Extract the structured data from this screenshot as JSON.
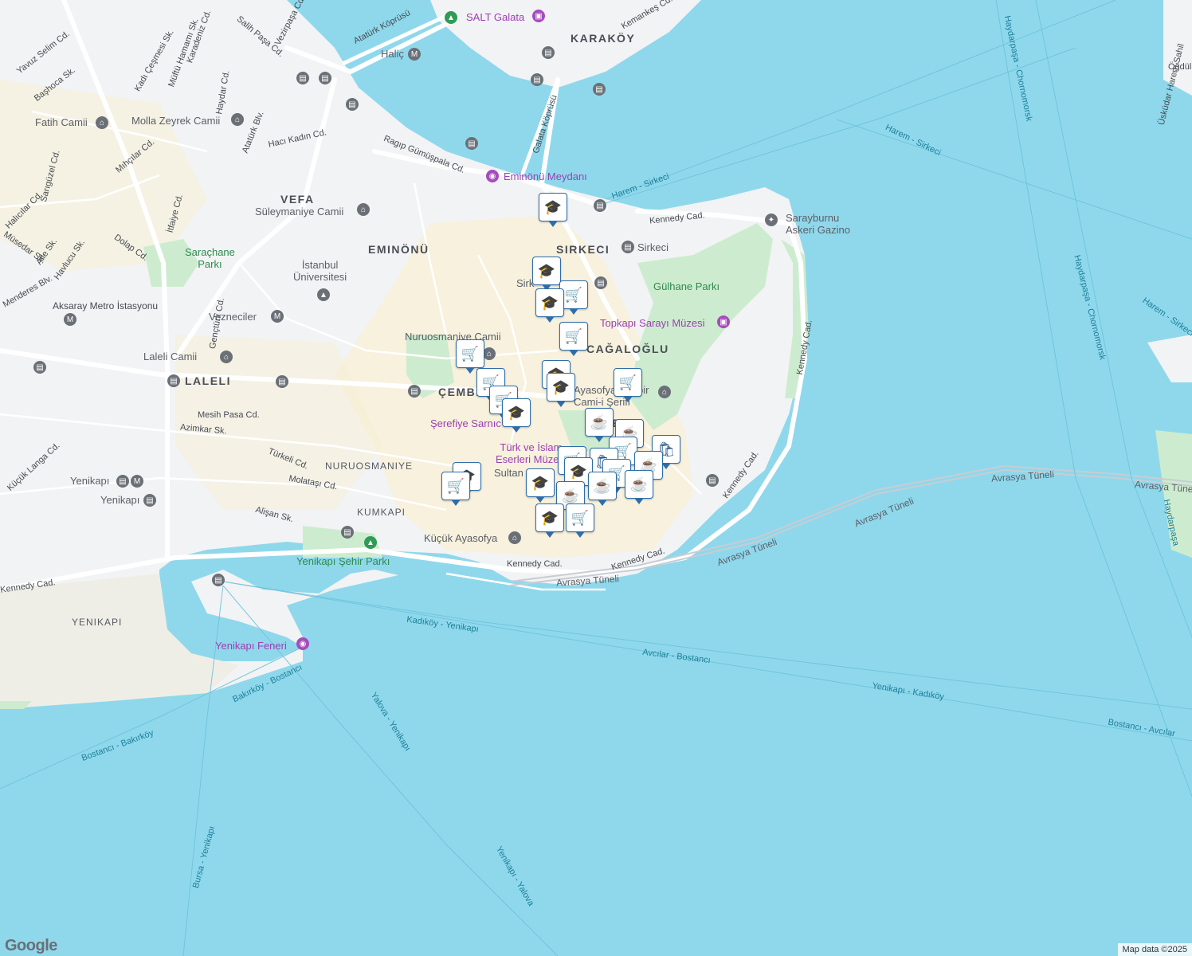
{
  "map": {
    "attribution": "Map data ©2025",
    "logo": "Google",
    "colors": {
      "water": "#8fd8ec",
      "land": "#f2f3f4",
      "park": "#cdeccf",
      "road": "#ffffff",
      "tourist": "#f8f0d5",
      "pin_border": "#2e6da8",
      "poi_purple": "#9c3fb3"
    }
  },
  "districts": {
    "karakoy": "KARAKÖY",
    "sirkeci": "SIRKECI",
    "eminonu": "EMINÖNÜ",
    "vefa": "VEFA",
    "laleli": "LALELI",
    "cagaloglu": "CAĞALOĞLU",
    "cemberlitas": "ÇEMBE",
    "nuruosmaniye": "NURUOSMANIYE",
    "kumkapi": "KUMKAPI",
    "yenikapi": "YENIKAPI",
    "sultanahmet": "S         MET"
  },
  "streets": {
    "yavuz_selim": "Yavuz Selim Cd.",
    "bashoca": "Başhoca Sk.",
    "kadi_cesmesi": "Kadı Çeşmesi Sk.",
    "muftu_hamami": "Müftü Hamamı Sk.",
    "karadeniz": "Karadeniz Cd.",
    "salih_pasa": "Salih Paşa Cd.",
    "vezirpasa": "Vezirpaşa Cd.",
    "haydar": "Haydar Cd.",
    "ataturk_bulv": "Atatürk Blv.",
    "haci_kadin": "Hacı Kadın Cd.",
    "mihcilar": "Mıhçılar Cd.",
    "sarigüzel": "Sarıgüzel Cd.",
    "halicilar": "Halıcılar Cd.",
    "itfaiye": "İtfaiye Cd.",
    "dolap": "Dolap Cd.",
    "mesedar": "Müsedar Sk.",
    "alle": "Alle Sk.",
    "havlucu": "Havlucu Sk.",
    "menderes": "Menderes Blv.",
    "aksaray_metro": "Aksaray Metro İstasyonu",
    "gencturk": "Gençtürk Cd.",
    "ragip": "Ragıp Gümüşpala Cd.",
    "kennedy1": "Kennedy Cad.",
    "kennedy2": "Kennedy Cad.",
    "kennedy3": "Kennedy Cad.",
    "kennedy4": "Kennedy Cad.",
    "kennedy5": "Kennedy Cad.",
    "kennedy6": "Kennedy Cad.",
    "kemankes": "Kemankeş Cd.",
    "mesih_pasa": "Mesih Pasa Cd.",
    "azimkar": "Azimkar Sk.",
    "kucuk_langa": "Küçük Langa Cd.",
    "turkeli": "Türkeli Cd.",
    "molatasi": "Molataşı Cd.",
    "alisan": "Alişan Sk.",
    "ataturk_koprusu": "Atatürk Köprüsü",
    "galata_koprusu": "Galata Köprüsü"
  },
  "pois": {
    "salt_galata": "SALT Galata",
    "halic": "Haliç",
    "fatih_camii": "Fatih Camii",
    "molla_zeyrek": "Molla Zeyrek Camii",
    "suleymaniye": "Süleymaniye Camii",
    "sarachane": "Saraçhane\nParkı",
    "istanbul_uni": "İstanbul\nÜniversitesi",
    "vezneciler": "Vezneciler",
    "eminonu_meydani": "Eminönü Meydanı",
    "nuruosmaniye_camii": "Nuruosmaniye Camii",
    "laleli_camii": "Laleli Camii",
    "gulhane": "Gülhane Parkı",
    "topkapi": "Topkapı Sarayı Müzesi",
    "sarayburnu": "Sarayburnu\nAskeri Gazino",
    "sirkeci_station": "Sirkeci",
    "serefiye": "Şerefiye Sarnıc",
    "ayasofya": "Ayasofya-i Kebir\nCami-i Şerifi",
    "turk_islam": "Türk ve İslam\nEserleri Müzesi",
    "sultan": "Sultan",
    "kucuk_ayasofya": "Küçük Ayasofya",
    "yenikapi_park": "Yenikapı Şehir Parkı",
    "yenikapi_feneri": "Yenikapı Feneri",
    "yenikapi_station1": "Yenikapı",
    "yenikapi_station2": "Yenikapı",
    "sirk_short": "Sirk"
  },
  "ferries": {
    "harem_sirkeci1": "Harem - Sirkeci",
    "harem_sirkeci2": "Harem - Sirkeci",
    "haydarpasa1": "Haydarpaşa - Chornomorsk",
    "haydarpasa2": "Haydarpaşa - Chornomorsk",
    "haydarpasa3": "Haydarpaşa",
    "harem_sirkeci3": "Harem - Sirkeci",
    "kadikoy_yenikapi": "Kadıköy - Yenikapı",
    "avcilar_bostanci": "Avcılar - Bostancı",
    "yenikapi_kadikoy": "Yenikapı - Kadıköy",
    "bostanci_avcilar": "Bostancı - Avcılar",
    "bakirkoy_bostanci": "Bakırköy - Bostancı",
    "bostanci_bakirkoy": "Bostancı - Bakırköy",
    "yalova_yenikapi": "Yalova - Yenikapı",
    "bursa_yenikapi": "Bursa - Yenikapı",
    "yenikapi_yalova": "Yenikapı - Yalova",
    "uskudar_harem": "Üsküdar Harem Sahil",
    "ogdul": "Öğdül"
  },
  "tunnels": {
    "avrasya1": "Avrasya Tüneli",
    "avrasya2": "Avrasya Tüneli",
    "avrasya3": "Avrasya Tüneli",
    "avrasya4": "Avrasya Tüneli",
    "avrasya5": "Avrasya Tüne"
  },
  "markers": {
    "school_icon": "graduation-cap-icon",
    "shop_icon": "shopping-cart-icon",
    "cafe_icon": "coffee-cup-icon",
    "bag_icon": "shopping-bag-icon",
    "school_glyph": "🎓",
    "shop_glyph": "🛒",
    "cafe_glyph": "☕",
    "bag_glyph": "🛍"
  }
}
